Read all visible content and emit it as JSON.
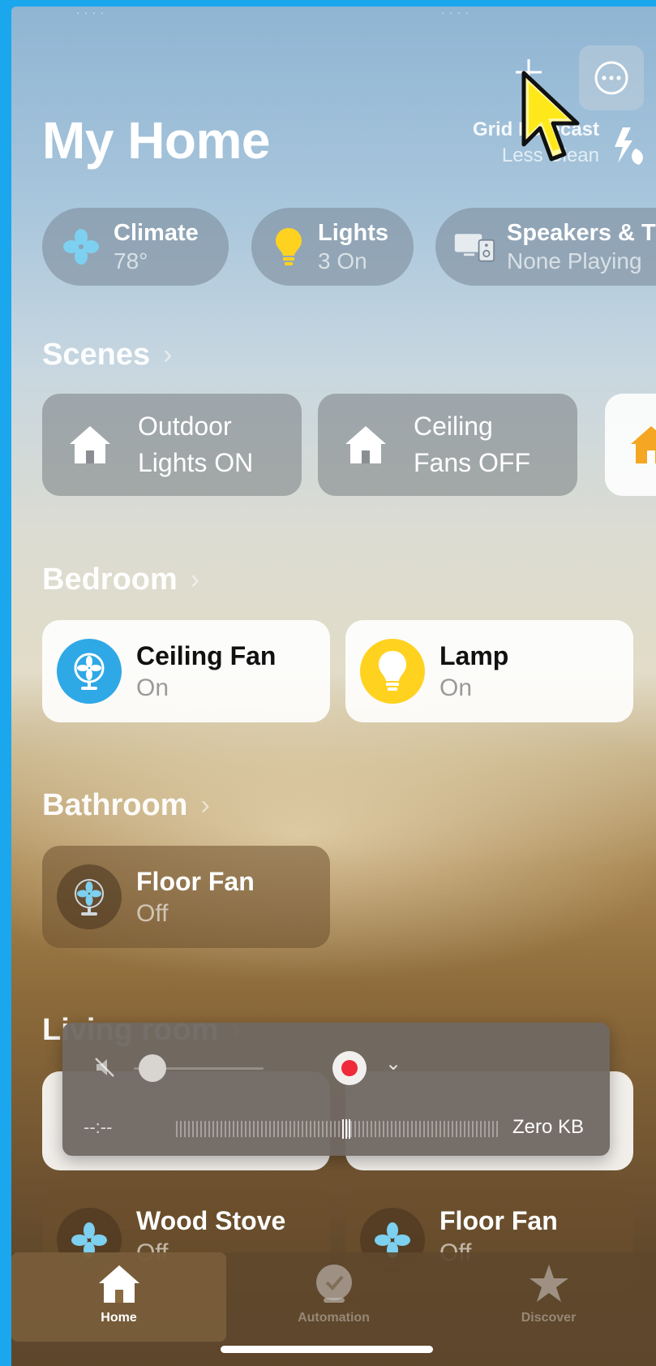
{
  "app": {
    "title": "My Home"
  },
  "header": {
    "grid_forecast_title": "Grid Forecast",
    "grid_forecast_sub": "Less Clean"
  },
  "chips": [
    {
      "name": "Climate",
      "value": "78°"
    },
    {
      "name": "Lights",
      "value": "3 On"
    },
    {
      "name": "Speakers & TVs",
      "value": "None Playing"
    }
  ],
  "scenes": {
    "title": "Scenes",
    "items": [
      {
        "label": "Outdoor Lights ON"
      },
      {
        "label": "Ceiling Fans OFF"
      }
    ]
  },
  "bedroom": {
    "title": "Bedroom",
    "tiles": [
      {
        "name": "Ceiling Fan",
        "state": "On"
      },
      {
        "name": "Lamp",
        "state": "On"
      }
    ]
  },
  "bathroom": {
    "title": "Bathroom",
    "tiles": [
      {
        "name": "Floor Fan",
        "state": "Off"
      }
    ]
  },
  "living_room": {
    "title": "Living room",
    "tiles": [
      {
        "name": "Wood Stove",
        "state": "Off"
      },
      {
        "name": "Floor Fan",
        "state": "Off"
      }
    ]
  },
  "recorder": {
    "time": "--:--",
    "size": "Zero KB",
    "volume_level": 0.05
  },
  "tabbar": {
    "items": [
      {
        "label": "Home",
        "icon": "house-icon",
        "active": true
      },
      {
        "label": "Automation",
        "icon": "clock-icon",
        "active": false
      },
      {
        "label": "Discover",
        "icon": "star-icon",
        "active": false
      }
    ]
  },
  "colors": {
    "accent_blue": "#2fa8e6",
    "lamp_yellow": "#ffd21f",
    "fan_icon": "#7dd0ef",
    "record_red": "#ef2a3a",
    "frame": "#1aa7ee"
  }
}
